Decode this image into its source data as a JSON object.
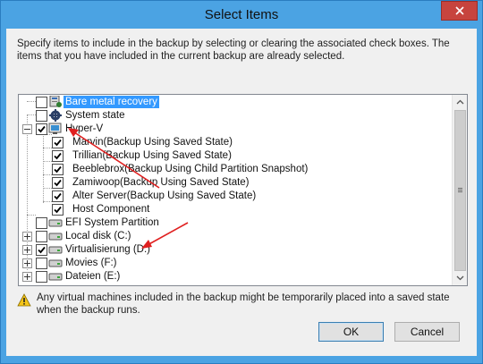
{
  "window": {
    "title": "Select Items",
    "close_icon": "close-icon"
  },
  "description": "Specify items to include in the backup by selecting or clearing the associated check boxes. The items that you have included in the current backup are already selected.",
  "tree": {
    "items": [
      {
        "label": "Bare metal recovery",
        "checked": false,
        "icon": "bare-metal-icon",
        "selected": true
      },
      {
        "label": "System state",
        "checked": false,
        "icon": "gear-icon"
      },
      {
        "label": "Hyper-V",
        "checked": true,
        "icon": "hyper-v-icon",
        "expanded": true
      },
      {
        "label": "Marvin(Backup Using Saved State)",
        "checked": true
      },
      {
        "label": "Trillian(Backup Using Saved State)",
        "checked": true
      },
      {
        "label": "Beeblebrox(Backup Using Child Partition Snapshot)",
        "checked": true
      },
      {
        "label": "Zamiwoop(Backup Using Saved State)",
        "checked": true
      },
      {
        "label": "Alter Server(Backup Using Saved State)",
        "checked": true
      },
      {
        "label": "Host Component",
        "checked": true
      },
      {
        "label": "EFI System Partition",
        "checked": false,
        "icon": "drive-icon"
      },
      {
        "label": "Local disk (C:)",
        "checked": false,
        "icon": "drive-icon",
        "expandable": true
      },
      {
        "label": "Virtualisierung (D:)",
        "checked": true,
        "icon": "drive-icon",
        "expandable": true
      },
      {
        "label": "Movies (F:)",
        "checked": false,
        "icon": "drive-icon",
        "expandable": true
      },
      {
        "label": "Dateien (E:)",
        "checked": false,
        "icon": "drive-icon",
        "expandable": true
      }
    ]
  },
  "warning": {
    "icon": "warning-icon",
    "text": "Any virtual machines included in the backup might be temporarily placed into a saved state when the backup runs."
  },
  "buttons": {
    "ok": "OK",
    "cancel": "Cancel"
  },
  "colors": {
    "title_bar": "#4ba3e3",
    "close_button": "#c7443e",
    "selection": "#3399ff",
    "annotation_arrow": "#e02020"
  }
}
